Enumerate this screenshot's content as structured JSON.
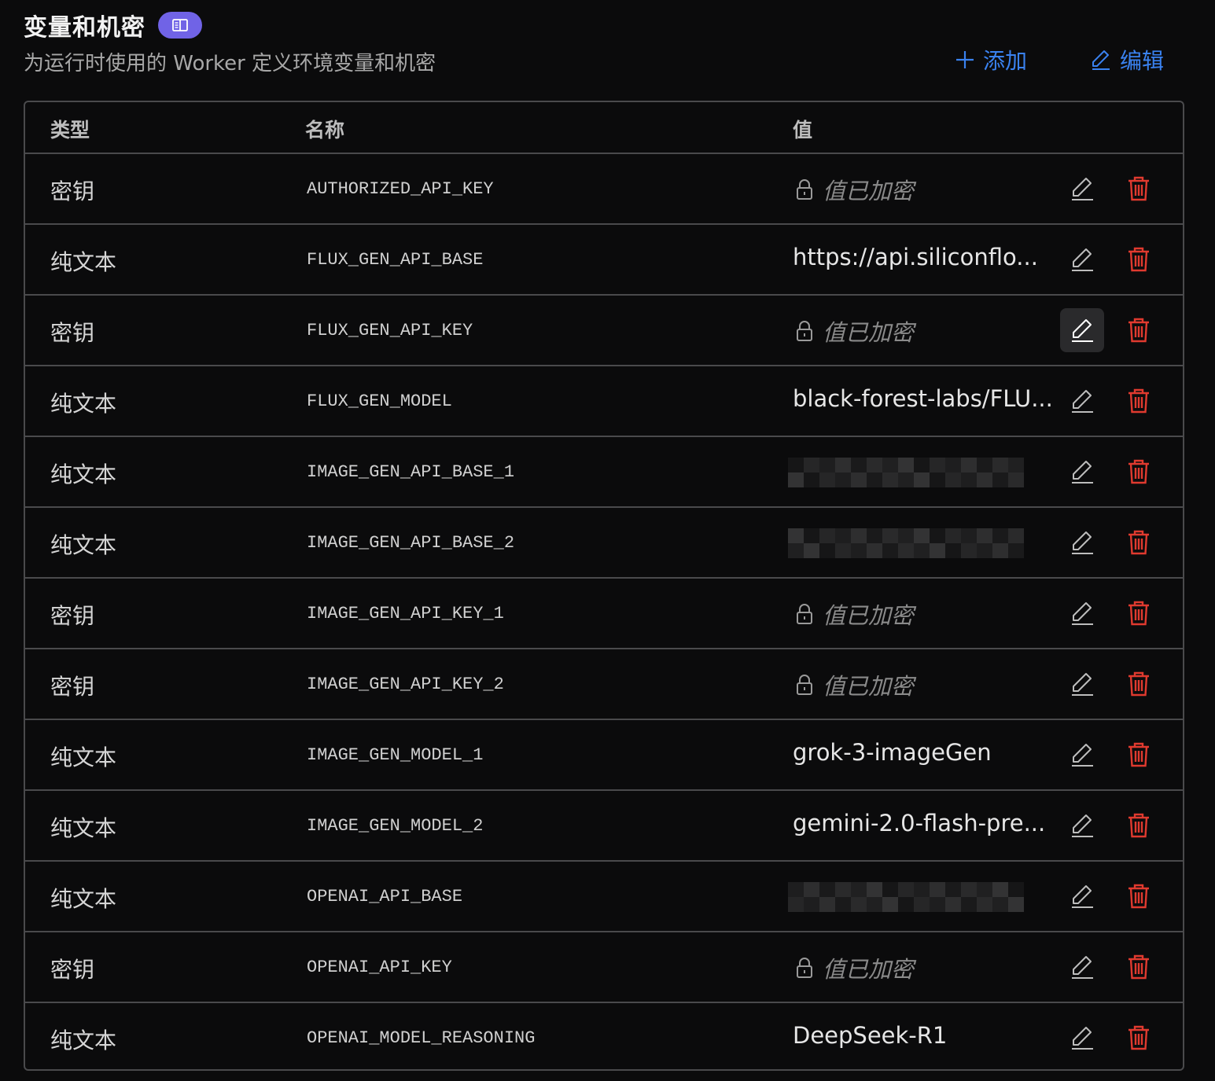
{
  "header": {
    "title": "变量和机密",
    "subtitle": "为运行时使用的 Worker 定义环境变量和机密",
    "badge_icon": "book-icon",
    "add_label": "添加",
    "edit_label": "编辑"
  },
  "colors": {
    "accent": "#3a82f0",
    "badge": "#7063e6",
    "danger": "#e03a2f",
    "background": "#0b0b0c",
    "border": "#4a4a4c"
  },
  "table": {
    "headers": {
      "type": "类型",
      "name": "名称",
      "value": "值"
    },
    "rows": [
      {
        "type": "密钥",
        "name": "AUTHORIZED_API_KEY",
        "value": "值已加密",
        "kind": "secret"
      },
      {
        "type": "纯文本",
        "name": "FLUX_GEN_API_BASE",
        "value": "https://api.siliconflo...",
        "kind": "text"
      },
      {
        "type": "密钥",
        "name": "FLUX_GEN_API_KEY",
        "value": "值已加密",
        "kind": "secret",
        "edit_hovered": true
      },
      {
        "type": "纯文本",
        "name": "FLUX_GEN_MODEL",
        "value": "black-forest-labs/FLU...",
        "kind": "text"
      },
      {
        "type": "纯文本",
        "name": "IMAGE_GEN_API_BASE_1",
        "value": "",
        "kind": "redacted"
      },
      {
        "type": "纯文本",
        "name": "IMAGE_GEN_API_BASE_2",
        "value": "",
        "kind": "redacted"
      },
      {
        "type": "密钥",
        "name": "IMAGE_GEN_API_KEY_1",
        "value": "值已加密",
        "kind": "secret"
      },
      {
        "type": "密钥",
        "name": "IMAGE_GEN_API_KEY_2",
        "value": "值已加密",
        "kind": "secret"
      },
      {
        "type": "纯文本",
        "name": "IMAGE_GEN_MODEL_1",
        "value": "grok-3-imageGen",
        "kind": "text"
      },
      {
        "type": "纯文本",
        "name": "IMAGE_GEN_MODEL_2",
        "value": "gemini-2.0-flash-pre...",
        "kind": "text"
      },
      {
        "type": "纯文本",
        "name": "OPENAI_API_BASE",
        "value": "",
        "kind": "redacted"
      },
      {
        "type": "密钥",
        "name": "OPENAI_API_KEY",
        "value": "值已加密",
        "kind": "secret"
      },
      {
        "type": "纯文本",
        "name": "OPENAI_MODEL_REASONING",
        "value": "DeepSeek-R1",
        "kind": "text"
      }
    ]
  }
}
